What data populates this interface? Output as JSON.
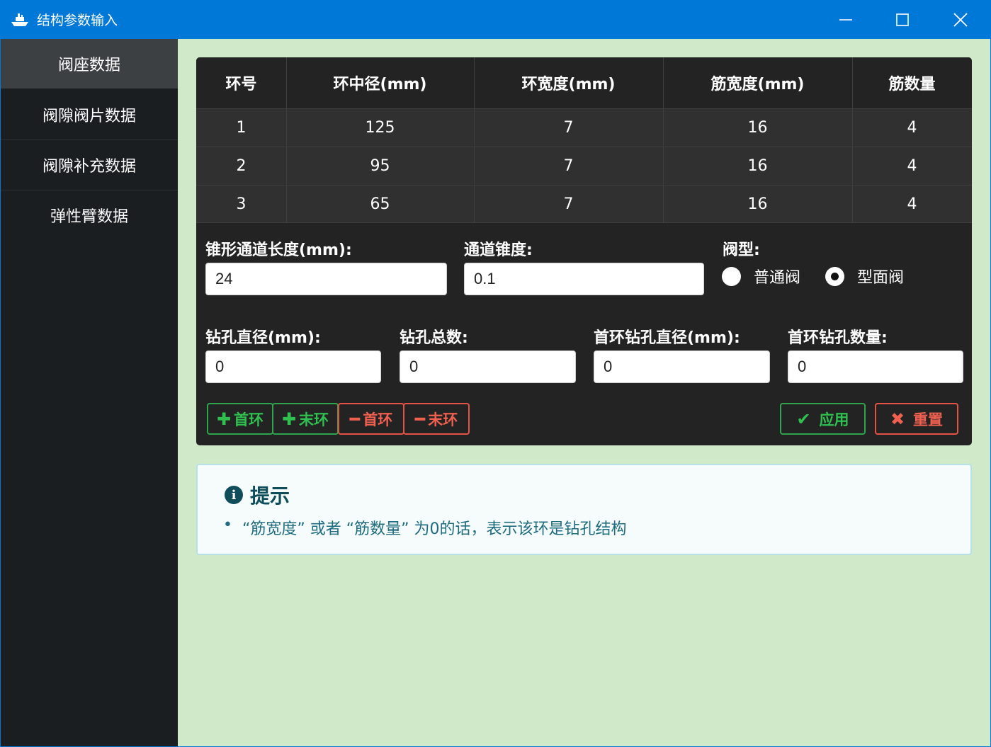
{
  "window": {
    "title": "结构参数输入",
    "app_icon": "ship-icon",
    "controls": {
      "minimize": "minimize-icon",
      "maximize": "maximize-icon",
      "close": "close-icon"
    }
  },
  "sidebar": {
    "items": [
      {
        "label": "阀座数据",
        "active": true
      },
      {
        "label": "阀隙阀片数据",
        "active": false
      },
      {
        "label": "阀隙补充数据",
        "active": false
      },
      {
        "label": "弹性臂数据",
        "active": false
      }
    ]
  },
  "table": {
    "headers": [
      "环号",
      "环中径(mm)",
      "环宽度(mm)",
      "筋宽度(mm)",
      "筋数量"
    ],
    "rows": [
      [
        "1",
        "125",
        "7",
        "16",
        "4"
      ],
      [
        "2",
        "95",
        "7",
        "16",
        "4"
      ],
      [
        "3",
        "65",
        "7",
        "16",
        "4"
      ]
    ]
  },
  "form": {
    "cone_length_label": "锥形通道长度(mm):",
    "cone_length_value": "24",
    "taper_label": "通道锥度:",
    "taper_value": "0.1",
    "valve_type_label": "阀型:",
    "valve_type_options": [
      "普通阀",
      "型面阀"
    ],
    "valve_type_selected": "型面阀",
    "drill_diameter_label": "钻孔直径(mm):",
    "drill_diameter_value": "0",
    "drill_total_label": "钻孔总数:",
    "drill_total_value": "0",
    "first_ring_drill_diameter_label": "首环钻孔直径(mm):",
    "first_ring_drill_diameter_value": "0",
    "first_ring_drill_count_label": "首环钻孔数量:",
    "first_ring_drill_count_value": "0"
  },
  "buttons": {
    "add_first": "首环",
    "add_last": "末环",
    "remove_first": "首环",
    "remove_last": "末环",
    "apply": "应用",
    "reset": "重置"
  },
  "tip": {
    "title": "提示",
    "lines": [
      "“筋宽度” 或者 “筋数量” 为0的话，表示该环是钻孔结构"
    ]
  },
  "colors": {
    "titlebar": "#0078d7",
    "sidebar": "#1b1e21",
    "content_bg": "#d0e9c9",
    "panel": "#232323",
    "green": "#2ea44f",
    "red": "#e55347",
    "tip_text": "#1f6b80"
  }
}
